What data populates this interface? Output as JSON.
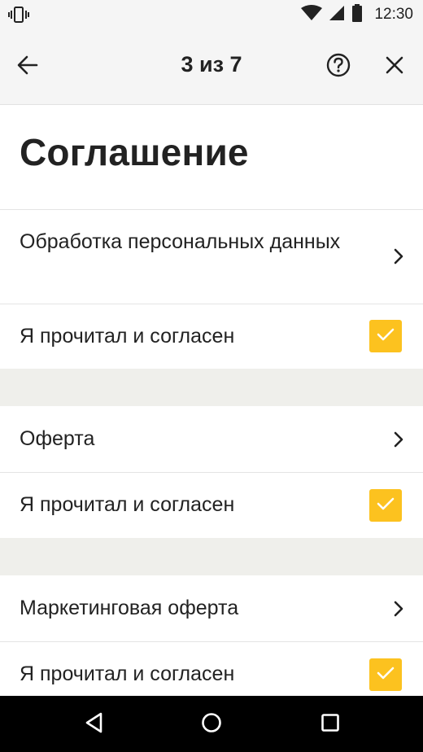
{
  "status_bar": {
    "time": "12:30",
    "icons": [
      "vibrate-icon",
      "wifi-icon",
      "signal-icon",
      "battery-icon"
    ]
  },
  "app_bar": {
    "title": "3 из 7",
    "back_icon": "arrow-left-icon",
    "help_icon": "help-circle-icon",
    "close_icon": "close-icon"
  },
  "page": {
    "heading": "Соглашение"
  },
  "sections": [
    {
      "link_label": "Обработка персональных данных",
      "consent_label": "Я прочитал и согласен",
      "checked": true
    },
    {
      "link_label": "Оферта",
      "consent_label": "Я прочитал и согласен",
      "checked": true
    },
    {
      "link_label": "Маркетинговая оферта",
      "consent_label": "Я прочитал и согласен",
      "checked": true
    }
  ],
  "nav_bar": {
    "icons": [
      "back-triangle-icon",
      "home-circle-icon",
      "recents-square-icon"
    ]
  },
  "colors": {
    "accent": "#fcc21f",
    "section_gap": "#efefeb",
    "app_bar_bg": "#f5f5f5",
    "text": "#222222"
  }
}
